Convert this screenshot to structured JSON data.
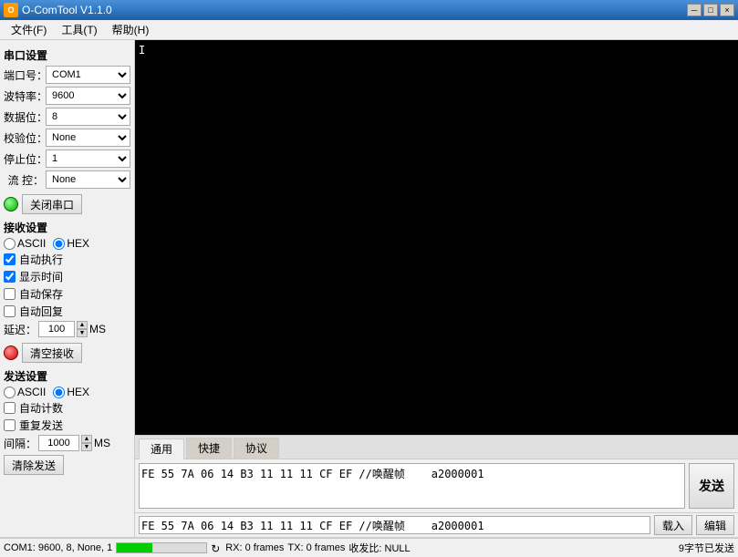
{
  "titleBar": {
    "title": "O-ComTool V1.1.0",
    "minimizeLabel": "－",
    "maximizeLabel": "□",
    "closeLabel": "×"
  },
  "menuBar": {
    "items": [
      {
        "label": "文件(F)"
      },
      {
        "label": "工具(T)"
      },
      {
        "label": "帮助(H)"
      }
    ]
  },
  "serialSettings": {
    "sectionTitle": "串口设置",
    "portLabel": "端口号：",
    "portValue": "COM1",
    "baudLabel": "波特率：",
    "baudValue": "9600",
    "dataBitsLabel": "数据位：",
    "dataBitsValue": "8",
    "parityLabel": "校验位：",
    "parityValue": "None",
    "stopBitsLabel": "停止位：",
    "stopBitsValue": "1",
    "flowLabel": "流  控：",
    "flowValue": "None",
    "connectBtn": "关闭串口"
  },
  "receiveSettings": {
    "sectionTitle": "接收设置",
    "asciiLabel": "ASCII",
    "hexLabel": "HEX",
    "autoExecLabel": "自动执行",
    "showTimeLabel": "显示时间",
    "autoSaveLabel": "自动保存",
    "autoReplyLabel": "自动回复",
    "delayLabel": "延迟：",
    "delayValue": "100",
    "msLabel": "MS",
    "clearBtn": "清空接收"
  },
  "sendSettings": {
    "sectionTitle": "发送设置",
    "asciiLabel": "ASCII",
    "hexLabel": "HEX",
    "autoCountLabel": "自动计数",
    "repeatLabel": "重复发送",
    "intervalLabel": "间隔：",
    "intervalValue": "1000",
    "msLabel": "MS",
    "clearSendBtn": "清除发送"
  },
  "sendTabs": {
    "tabs": [
      {
        "label": "通用"
      },
      {
        "label": "快捷"
      },
      {
        "label": "协议"
      }
    ],
    "activeTab": 0
  },
  "sendContent": {
    "text": "FE 55 7A 06 14 B3 11 11 11 CF EF //唤醒帧    a2000001",
    "sendBtn": "发送"
  },
  "bottomBar": {
    "inputValue": "FE 55 7A 06 14 B3 11 11 11 CF EF //唤醒帧    a2000001",
    "loadBtn": "载入",
    "editBtn": "编辑"
  },
  "statusBar": {
    "portInfo": "COM1: 9600, 8, None, 1",
    "rxLabel": "RX: 0 frames",
    "txLabel": "TX: 0 frames",
    "ratioLabel": "收发比: NULL",
    "byteInfo": "9字节已发送",
    "refreshIcon": "↻"
  },
  "receiveArea": {
    "cursorChar": "I"
  }
}
